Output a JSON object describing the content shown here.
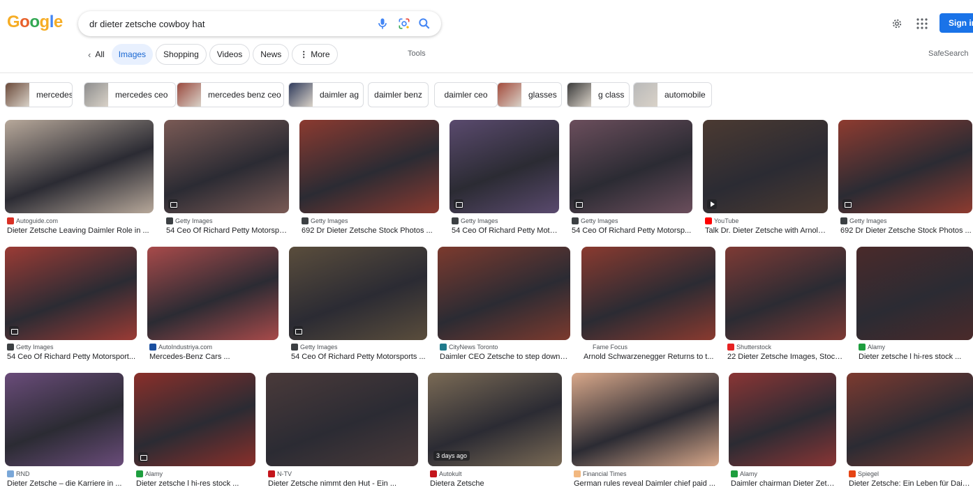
{
  "search": {
    "query": "dr dieter zetsche cowboy hat"
  },
  "header": {
    "logo_letters": [
      "G",
      "o",
      "o",
      "g",
      "l",
      "e"
    ],
    "logo_colors": [
      "#f6ad25",
      "#e8612c",
      "#33a853",
      "#f6ad25",
      "#4285f4",
      "#f6ad25"
    ],
    "sign_in": "Sign in"
  },
  "tabs": {
    "all": "All",
    "images": "Images",
    "shopping": "Shopping",
    "videos": "Videos",
    "news": "News",
    "more": "More",
    "tools": "Tools",
    "safesearch": "SafeSearch"
  },
  "chips": [
    {
      "label": "mercedes",
      "thumb": "#6b4a3a"
    },
    {
      "label": "mercedes ceo",
      "thumb": "#8d8d8d"
    },
    {
      "label": "mercedes benz ceo",
      "thumb": "#9a4a3f"
    },
    {
      "label": "daimler ag",
      "thumb": "#2f3b5c"
    },
    {
      "label": "daimler benz",
      "thumb": null
    },
    {
      "label": "daimler ceo",
      "thumb": null
    },
    {
      "label": "glasses",
      "thumb": "#a34b3c"
    },
    {
      "label": "g class",
      "thumb": "#3a3a3a"
    },
    {
      "label": "automobile",
      "thumb": "#b9b9b9"
    }
  ],
  "results": [
    {
      "source": "Autoguide.com",
      "title": "Dieter Zetsche Leaving Daimler Role in ...",
      "fav": "#d93025",
      "color": "#b7a89a",
      "badge": false
    },
    {
      "source": "Getty Images",
      "title": "54 Ceo Of Richard Petty Motorspo...",
      "fav": "#3c4043",
      "color": "#7a5a55",
      "badge": true
    },
    {
      "source": "Getty Images",
      "title": "692 Dr Dieter Zetsche Stock Photos ...",
      "fav": "#3c4043",
      "color": "#8b3a30",
      "badge": false
    },
    {
      "source": "Getty Images",
      "title": "54 Ceo Of Richard Petty Moto...",
      "fav": "#3c4043",
      "color": "#5a4a6e",
      "badge": true
    },
    {
      "source": "Getty Images",
      "title": "54 Ceo Of Richard Petty Motorsp...",
      "fav": "#3c4043",
      "color": "#6b4e5c",
      "badge": true
    },
    {
      "source": "YouTube",
      "title": "Talk Dr. Dieter Zetsche with Arnold...",
      "fav": "#ff0000",
      "color": "#4b3a32",
      "badge": false,
      "play": true
    },
    {
      "source": "Getty Images",
      "title": "692 Dr Dieter Zetsche Stock Photos ...",
      "fav": "#3c4043",
      "color": "#8e3b30",
      "badge": true
    },
    {
      "source": "Getty Images",
      "title": "54 Ceo Of Richard Petty Motorsport...",
      "fav": "#3c4043",
      "color": "#9b3b35",
      "badge": true
    },
    {
      "source": "AutoIndustriya.com",
      "title": "Mercedes-Benz Cars ...",
      "fav": "#1a4fa0",
      "color": "#a84a4a",
      "badge": false
    },
    {
      "source": "Getty Images",
      "title": "54 Ceo Of Richard Petty Motorsports ...",
      "fav": "#3c4043",
      "color": "#5a4d3c",
      "badge": true
    },
    {
      "source": "CityNews Toronto",
      "title": "Daimler CEO Zetsche to step down e...",
      "fav": "#1f7a8c",
      "color": "#7c3a2e",
      "badge": false
    },
    {
      "source": "Fame Focus",
      "title": "Arnold Schwarzenegger Returns to t...",
      "fav": "#ffffff",
      "color": "#8a3a2f",
      "badge": false
    },
    {
      "source": "Shutterstock",
      "title": "22 Dieter Zetsche Images, Stock ...",
      "fav": "#e62222",
      "color": "#7e3a34",
      "badge": false
    },
    {
      "source": "Alamy",
      "title": "Dieter zetsche l hi-res stock ...",
      "fav": "#1e9e3e",
      "color": "#4a2a2a",
      "badge": false
    },
    {
      "source": "RND",
      "title": "Dieter Zetsche – die Karriere in ...",
      "fav": "#7aa7d8",
      "color": "#6a4c7a",
      "badge": false
    },
    {
      "source": "Alamy",
      "title": "Dieter zetsche l hi-res stock ...",
      "fav": "#1e9e3e",
      "color": "#8a2f2a",
      "badge": true
    },
    {
      "source": "N-TV",
      "title": "Dieter Zetsche nimmt den Hut - Ein ...",
      "fav": "#c4151c",
      "color": "#4a3a3a",
      "badge": false
    },
    {
      "source": "Autokult",
      "title": "Dietera Zetsche",
      "fav": "#c4151c",
      "color": "#7a6a55",
      "badge": false,
      "time": "3 days ago"
    },
    {
      "source": "Financial Times",
      "title": "German rules reveal Daimler chief paid ...",
      "fav": "#f2b880",
      "color": "#d9a88a",
      "badge": false
    },
    {
      "source": "Alamy",
      "title": "Daimler chairman Dieter Zets...",
      "fav": "#1e9e3e",
      "color": "#8a3535",
      "badge": false
    },
    {
      "source": "Spiegel",
      "title": "Dieter Zetsche: Ein Leben für Daiml...",
      "fav": "#e64415",
      "color": "#7c3a30",
      "badge": false
    }
  ]
}
